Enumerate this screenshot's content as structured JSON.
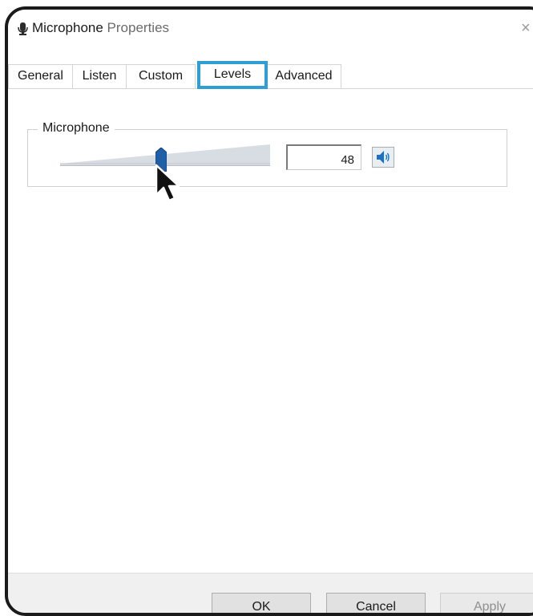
{
  "window": {
    "title_main": "Microphone",
    "title_rest": " Properties",
    "close_glyph": "×"
  },
  "tabs": [
    {
      "label": "General",
      "active": false
    },
    {
      "label": "Listen",
      "active": false
    },
    {
      "label": "Custom",
      "active": false
    },
    {
      "label": "Levels",
      "active": true
    },
    {
      "label": "Advanced",
      "active": false
    }
  ],
  "levels": {
    "group_label": "Microphone",
    "slider_value": 48,
    "slider_max": 100,
    "value_text": "48",
    "speaker_icon": "speaker-icon"
  },
  "footer": {
    "ok_label": "OK",
    "cancel_label": "Cancel",
    "apply_label": "Apply"
  },
  "colors": {
    "active_tab_highlight": "#2f9ed3",
    "slider_thumb": "#1f5fa8",
    "speaker_icon": "#1f6fc4"
  }
}
